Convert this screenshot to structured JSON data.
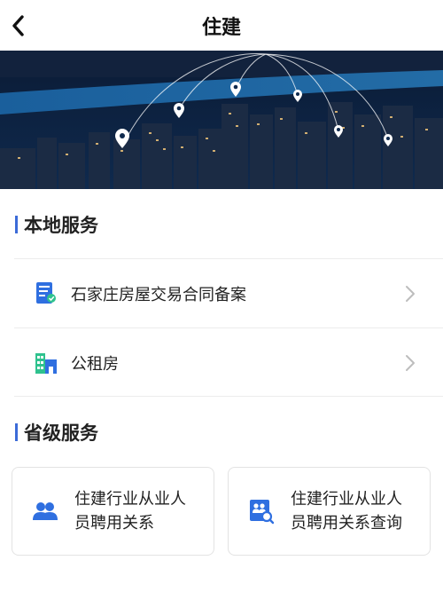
{
  "header": {
    "title": "住建",
    "back_icon": "chevron-left-icon"
  },
  "banner": {
    "image": "city-night-skyline-with-location-pins"
  },
  "local_services": {
    "title": "本地服务",
    "items": [
      {
        "label": "石家庄房屋交易合同备案",
        "icon": "contract-document-icon"
      },
      {
        "label": "公租房",
        "icon": "building-icon"
      }
    ]
  },
  "provincial_services": {
    "title": "省级服务",
    "cards": [
      {
        "label": "住建行业从业人员聘用关系",
        "icon": "people-icon"
      },
      {
        "label": "住建行业从业人员聘用关系查询",
        "icon": "people-search-icon"
      }
    ]
  },
  "colors": {
    "accent": "#3c6bd8",
    "icon_blue": "#2f6fe0",
    "icon_green": "#2fc28e"
  }
}
